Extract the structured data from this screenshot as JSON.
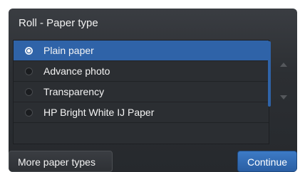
{
  "header": {
    "title": "Roll - Paper type"
  },
  "paper_types": {
    "selected_index": 0,
    "options": [
      {
        "label": "Plain paper",
        "selected": true
      },
      {
        "label": "Advance photo",
        "selected": false
      },
      {
        "label": "Transparency",
        "selected": false
      },
      {
        "label": "HP Bright White IJ Paper",
        "selected": false
      }
    ]
  },
  "scroll": {
    "up_icon": "triangle-up-icon",
    "down_icon": "triangle-down-icon"
  },
  "buttons": {
    "more_label": "More paper types",
    "continue_label": "Continue"
  },
  "colors": {
    "accent": "#2f63a8",
    "background": "#2c2f33",
    "text": "#f4f4f4"
  }
}
